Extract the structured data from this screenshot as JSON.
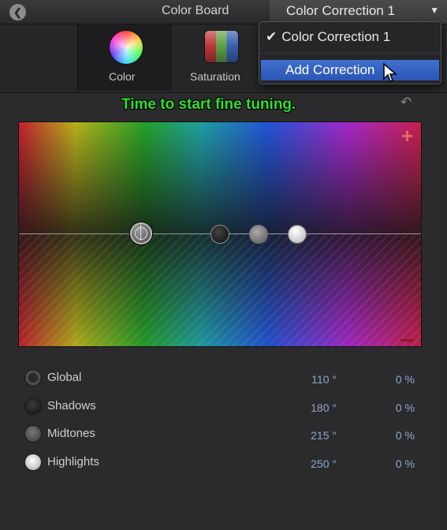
{
  "header": {
    "title": "Color Board",
    "correction_select": "Color Correction 1",
    "dropdown_arrow": "▼"
  },
  "tabs": [
    {
      "label": "Color"
    },
    {
      "label": "Saturation"
    }
  ],
  "dropdown_menu": {
    "items": [
      {
        "label": "Color Correction 1",
        "checked": true
      },
      {
        "label": "Add Correction",
        "highlighted": true
      }
    ]
  },
  "annotation": {
    "text": "Time to start fine tuning."
  },
  "controls": [
    {
      "name": "Global",
      "angle": "110",
      "percent": "0 %"
    },
    {
      "name": "Shadows",
      "angle": "180",
      "percent": "0 %"
    },
    {
      "name": "Midtones",
      "angle": "215",
      "percent": "0 %"
    },
    {
      "name": "Highlights",
      "angle": "250",
      "percent": "0 %"
    }
  ],
  "degree_symbol": "°",
  "icons": {
    "back": "back-arrow-icon",
    "undo": "undo-icon",
    "plus": "plus-icon",
    "minus": "minus-icon"
  },
  "colors": {
    "annotation": "#2fe02f",
    "highlight": "#2a56b4",
    "value_text": "#8fa6c9"
  }
}
